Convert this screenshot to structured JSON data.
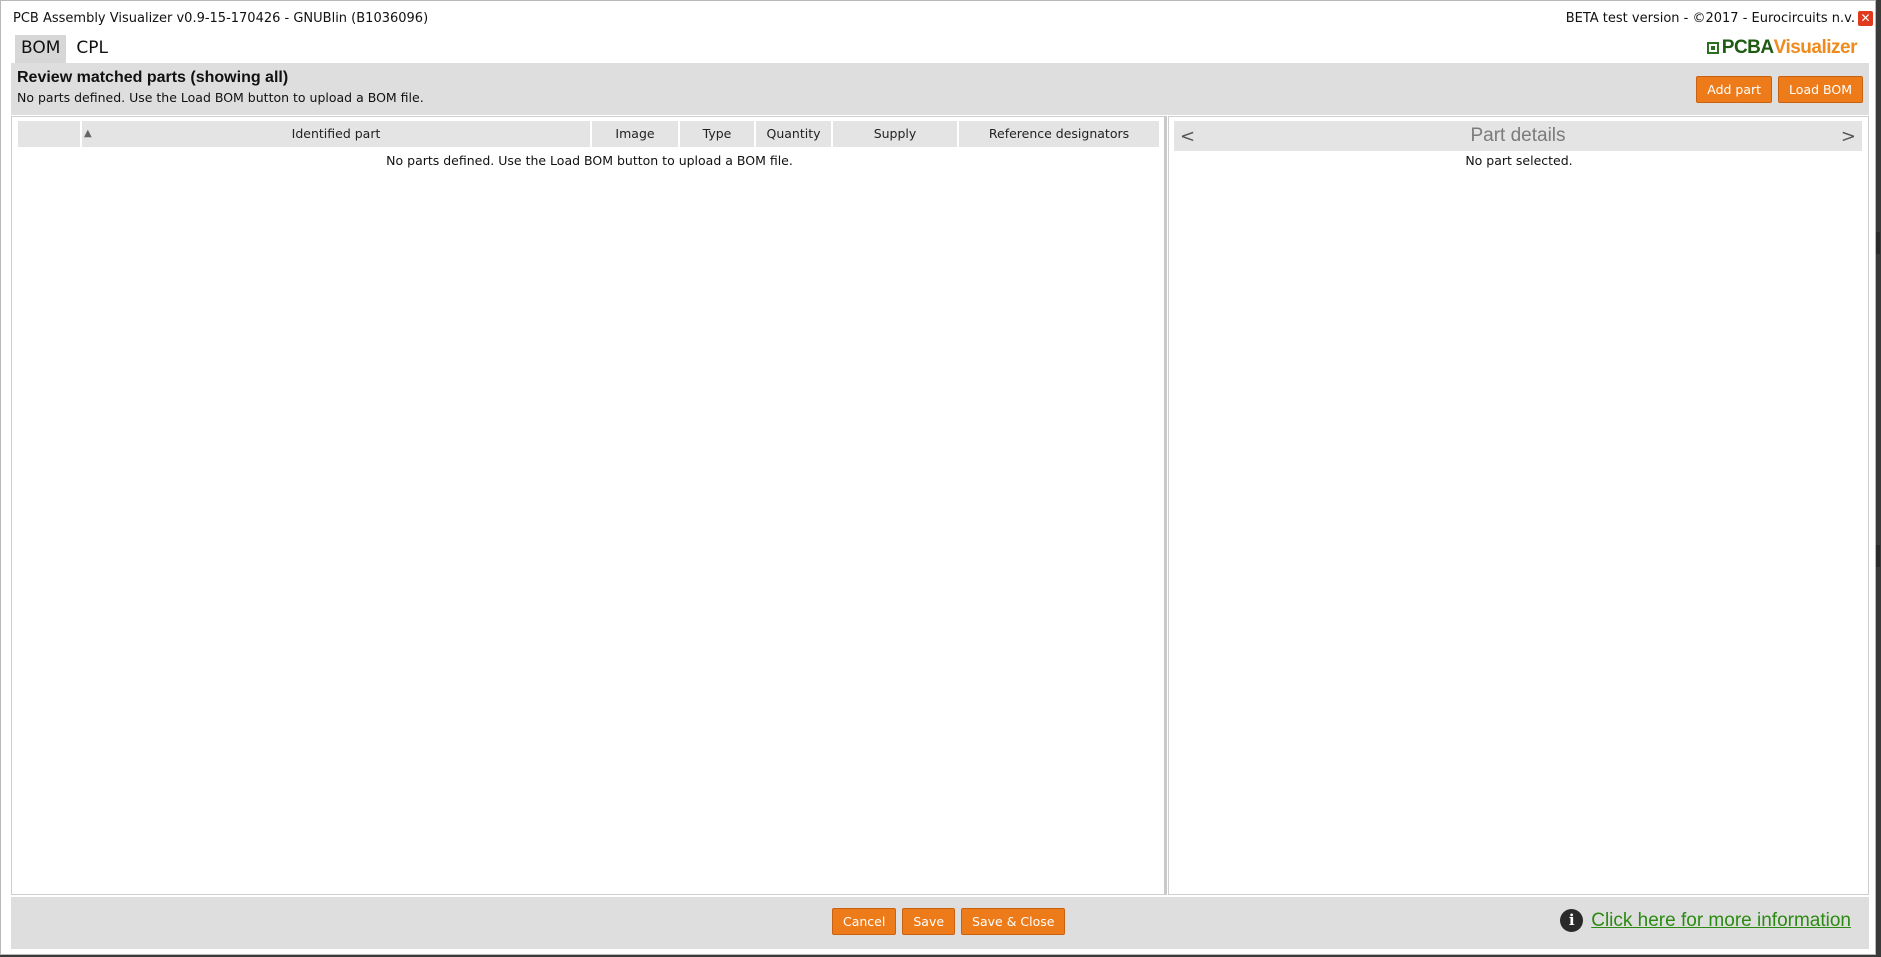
{
  "window": {
    "title": "PCB Assembly Visualizer v0.9-15-170426 - GNUBlin (B1036096)",
    "right_text": "BETA test version - ©2017 - Eurocircuits n.v.",
    "close_symbol": "✕"
  },
  "tabs": [
    {
      "label": "BOM",
      "active": true
    },
    {
      "label": "CPL",
      "active": false
    }
  ],
  "logo": {
    "part_a": "PCBA",
    "part_b": "Visualizer"
  },
  "header": {
    "title": "Review matched parts (showing all)",
    "subtitle": "No parts defined. Use the Load BOM button to upload a BOM file.",
    "buttons": {
      "add_part": "Add part",
      "load_bom": "Load BOM"
    }
  },
  "table": {
    "sort_indicator": "▲",
    "columns": [
      "",
      "Identified part",
      "Image",
      "Type",
      "Quantity",
      "Supply",
      "Reference designators"
    ],
    "empty_message": "No parts defined. Use the Load BOM button to upload a BOM file."
  },
  "part_details": {
    "prev": "<",
    "title": "Part details",
    "next": ">",
    "empty_message": "No part selected."
  },
  "footer": {
    "cancel": "Cancel",
    "save": "Save",
    "save_close": "Save & Close",
    "info_icon": "i",
    "info_link": "Click here for more information"
  },
  "colors": {
    "accent": "#ee7b1a",
    "link": "#2b8a12",
    "band": "#dedede"
  }
}
